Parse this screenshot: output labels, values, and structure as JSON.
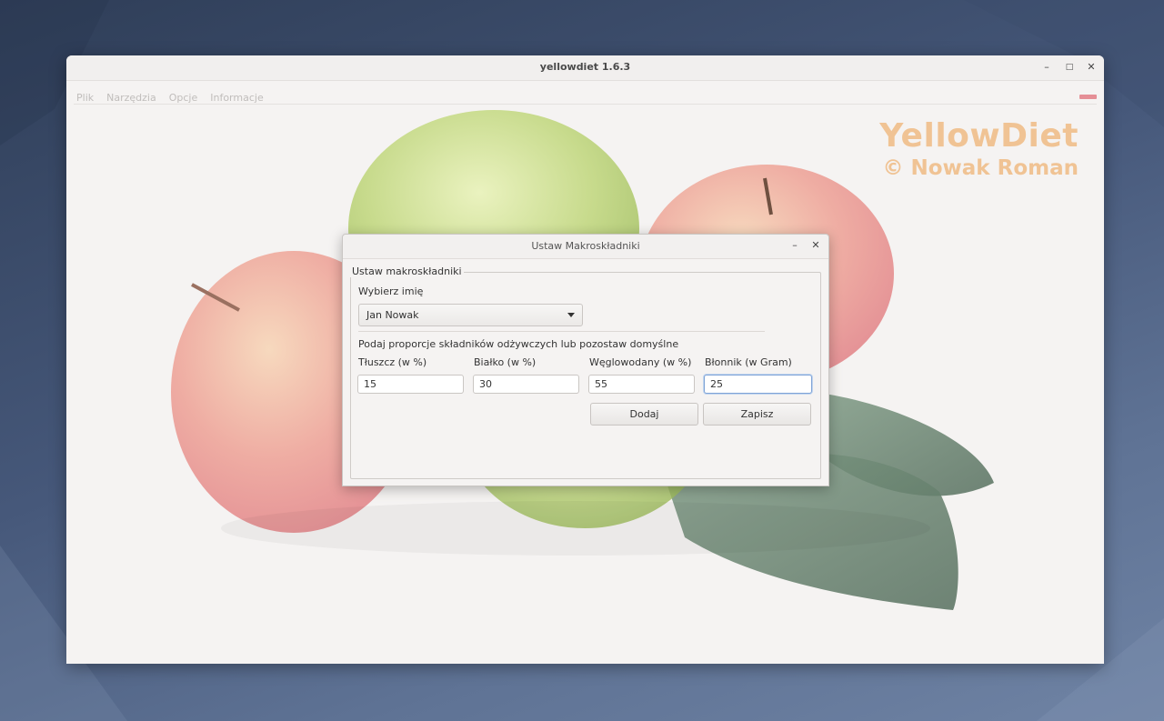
{
  "window": {
    "title": "yellowdiet 1.6.3",
    "controls": {
      "minimize": "–",
      "maximize": "□",
      "close": "✕"
    }
  },
  "menu": {
    "items": [
      {
        "label": "Plik"
      },
      {
        "label": "Narzędzia"
      },
      {
        "label": "Opcje"
      },
      {
        "label": "Informacje"
      }
    ]
  },
  "brand": {
    "name": "YellowDiet",
    "copyright": "© Nowak Roman",
    "color": "#f0c394"
  },
  "dialog": {
    "title": "Ustaw Makroskładniki",
    "controls": {
      "minimize": "–",
      "close": "✕"
    },
    "group_title": "Ustaw makroskładniki",
    "name_label": "Wybierz imię",
    "name_selected": "Jan Nowak",
    "proportions_label": "Podaj proporcje składników odżywczych lub pozostaw domyślne",
    "fields": {
      "fat_label": "Tłuszcz (w %)",
      "fat_value": "15",
      "protein_label": "Białko (w %)",
      "protein_value": "30",
      "carbs_label": "Węglowodany (w %)",
      "carbs_value": "55",
      "fiber_label": "Błonnik (w Gram)",
      "fiber_value": "25"
    },
    "buttons": {
      "add": "Dodaj",
      "save": "Zapisz"
    }
  },
  "colors": {
    "accent_red": "#e58f96",
    "focus_blue": "#7fa3d6"
  }
}
